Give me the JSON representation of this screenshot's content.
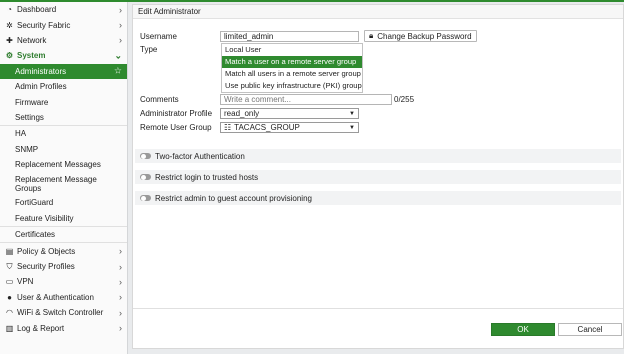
{
  "sidebar": {
    "items": [
      {
        "label": "Dashboard",
        "icon": "dashboard-icon"
      },
      {
        "label": "Security Fabric",
        "icon": "fabric-icon"
      },
      {
        "label": "Network",
        "icon": "network-icon"
      },
      {
        "label": "System",
        "icon": "gear-icon"
      },
      {
        "label": "Administrators"
      },
      {
        "label": "Admin Profiles"
      },
      {
        "label": "Firmware"
      },
      {
        "label": "Settings"
      },
      {
        "label": "HA"
      },
      {
        "label": "SNMP"
      },
      {
        "label": "Replacement Messages"
      },
      {
        "label": "Replacement Message Groups"
      },
      {
        "label": "FortiGuard"
      },
      {
        "label": "Feature Visibility"
      },
      {
        "label": "Certificates"
      },
      {
        "label": "Policy & Objects",
        "icon": "policy-icon"
      },
      {
        "label": "Security Profiles",
        "icon": "shield-icon"
      },
      {
        "label": "VPN",
        "icon": "monitor-icon"
      },
      {
        "label": "User & Authentication",
        "icon": "user-icon"
      },
      {
        "label": "WiFi & Switch Controller",
        "icon": "wifi-icon"
      },
      {
        "label": "Log & Report",
        "icon": "chart-icon"
      }
    ]
  },
  "main": {
    "title": "Edit Administrator",
    "username_label": "Username",
    "username_value": "limited_admin",
    "change_backup_password": "Change Backup Password",
    "type_label": "Type",
    "type_options": [
      "Local User",
      "Match a user on a remote server group",
      "Match all users in a remote server group",
      "Use public key infrastructure (PKI) group"
    ],
    "comments_label": "Comments",
    "comments_placeholder": "Write a comment...",
    "comments_counter": "0/255",
    "admin_profile_label": "Administrator Profile",
    "admin_profile_value": "read_only",
    "remote_group_label": "Remote User Group",
    "remote_group_value": "TACACS_GROUP",
    "two_factor": "Two-factor Authentication",
    "trusted_hosts": "Restrict login to trusted hosts",
    "guest_provisioning": "Restrict admin to guest account provisioning",
    "ok": "OK",
    "cancel": "Cancel"
  },
  "colors": {
    "accent": "#2f8a2f",
    "section_text": "#2f7d2f"
  }
}
